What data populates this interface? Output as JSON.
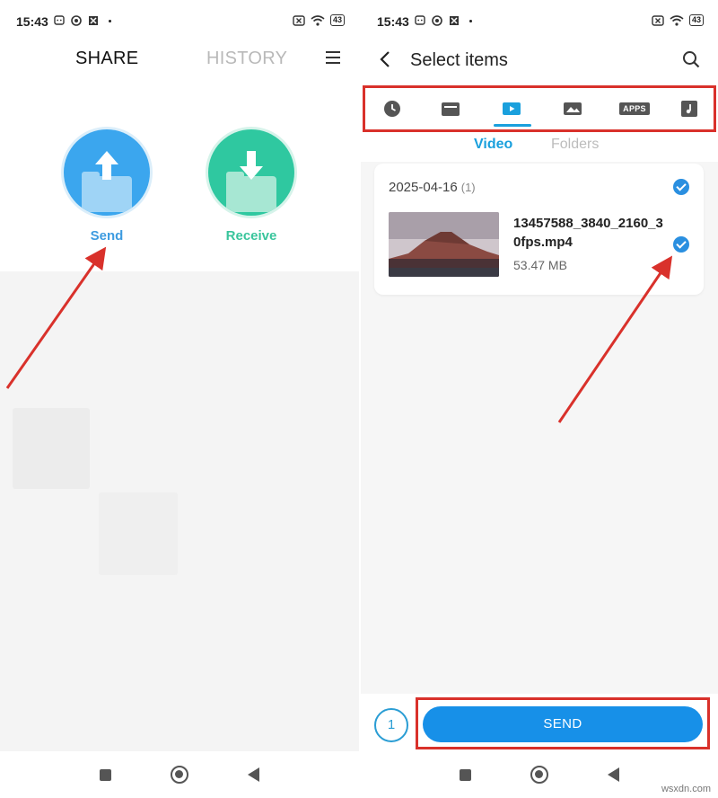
{
  "status_bar": {
    "time": "15:43",
    "battery": "43"
  },
  "left_screen": {
    "tabs": {
      "share": "SHARE",
      "history": "HISTORY"
    },
    "actions": {
      "send_label": "Send",
      "receive_label": "Receive"
    },
    "colors": {
      "send": "#3ba6ee",
      "receive": "#2fc8a0"
    }
  },
  "right_screen": {
    "title": "Select items",
    "categories": [
      "recent-icon",
      "folder-icon",
      "video-icon",
      "image-icon",
      "APPS",
      "music-icon"
    ],
    "subtabs": {
      "video": "Video",
      "folders": "Folders"
    },
    "group": {
      "date": "2025-04-16",
      "count": "(1)"
    },
    "file": {
      "name": "13457588_3840_2160_30fps.mp4",
      "size": "53.47 MB",
      "selected": true
    },
    "selected_count": "1",
    "send_button": "SEND",
    "accent": "#1790e8"
  },
  "annotations": {
    "highlight_color": "#d9312b"
  },
  "watermark": "wsxdn.com"
}
